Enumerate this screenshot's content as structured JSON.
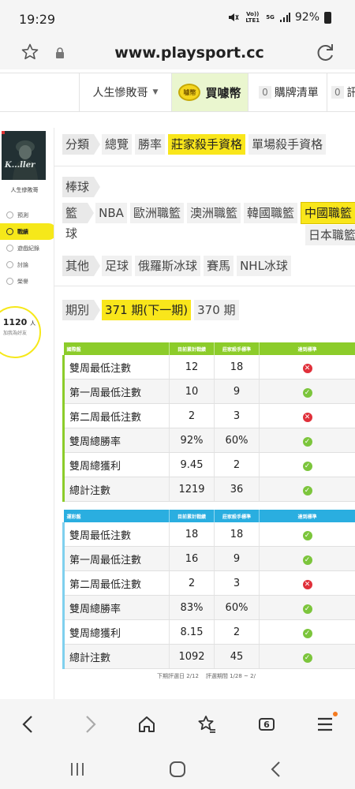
{
  "status": {
    "time": "19:29",
    "volte": "Vo)) LTE1",
    "network": "5G",
    "battery": "92%"
  },
  "browser": {
    "url": "www.playsport.cc",
    "tab_count": "6"
  },
  "topnav": {
    "user": "人生慘敗哥",
    "buy": "買噱幣",
    "coin_label": "噱幣",
    "cart_count": "0",
    "cart": "購牌清單",
    "msg_count": "0",
    "msg": "訊"
  },
  "sidebar": {
    "avatar_text": "K...ller",
    "name": "人生慘敗哥",
    "items": [
      {
        "label": "預測"
      },
      {
        "label": "戰績"
      },
      {
        "label": "遊戲紀錄"
      },
      {
        "label": "討論"
      },
      {
        "label": "榮譽"
      }
    ],
    "points": "1120",
    "points_prefix": "有",
    "points_suffix": "人",
    "points_sub": "加我為好友"
  },
  "filters": {
    "category_label": "分類",
    "categories": [
      "總覽",
      "勝率",
      "莊家殺手資格",
      "單場殺手資格"
    ],
    "baseball_label": "棒球",
    "basketball_label": "籃球",
    "basketball": [
      "NBA",
      "歐洲職籃",
      "澳洲職籃",
      "韓國職籃",
      "中國職籃",
      "日本職籃"
    ],
    "other_label": "其他",
    "other": [
      "足球",
      "俄羅斯冰球",
      "賽馬",
      "NHL冰球"
    ],
    "period_label": "期別",
    "periods": [
      "371 期(下一期)",
      "370 期"
    ]
  },
  "table1": {
    "headers": [
      "國際盤",
      "目前累計戰績",
      "莊家殺手標準",
      "達到標準"
    ],
    "rows": [
      {
        "name": "雙周最低注數",
        "current": "12",
        "standard": "18",
        "status": "fail"
      },
      {
        "name": "第一周最低注數",
        "current": "10",
        "standard": "9",
        "status": "pass"
      },
      {
        "name": "第二周最低注數",
        "current": "2",
        "standard": "3",
        "status": "fail"
      },
      {
        "name": "雙周總勝率",
        "current": "92%",
        "standard": "60%",
        "status": "pass"
      },
      {
        "name": "雙周總獲利",
        "current": "9.45",
        "standard": "2",
        "status": "pass"
      },
      {
        "name": "總計注數",
        "current": "1219",
        "standard": "36",
        "status": "pass"
      }
    ]
  },
  "table2": {
    "headers": [
      "運彩盤",
      "目前累計戰績",
      "莊家殺手標準",
      "達到標準"
    ],
    "rows": [
      {
        "name": "雙周最低注數",
        "current": "18",
        "standard": "18",
        "status": "pass"
      },
      {
        "name": "第一周最低注數",
        "current": "16",
        "standard": "9",
        "status": "pass"
      },
      {
        "name": "第二周最低注數",
        "current": "2",
        "standard": "3",
        "status": "fail"
      },
      {
        "name": "雙周總勝率",
        "current": "83%",
        "standard": "60%",
        "status": "pass"
      },
      {
        "name": "雙周總獲利",
        "current": "8.15",
        "standard": "2",
        "status": "pass"
      },
      {
        "name": "總計注數",
        "current": "1092",
        "standard": "45",
        "status": "pass"
      }
    ]
  },
  "footnote": {
    "next": "下期評選日 2/12",
    "range": "評選期間 1/28 ~ 2/"
  },
  "colors": {
    "accent_yellow": "#f9e61b",
    "intl_green": "#8ccc2a",
    "lottery_blue": "#2aaee0",
    "pass": "#7cc53c",
    "fail": "#e0303a"
  },
  "icons": [
    "mute-icon",
    "wifi-icon",
    "signal-icon",
    "battery-icon",
    "bookmark-star-icon",
    "lock-icon",
    "reload-icon",
    "back-icon",
    "forward-icon",
    "home-icon",
    "bookmarks-icon",
    "tabs-icon",
    "menu-icon",
    "recent-apps-icon",
    "android-home-icon",
    "android-back-icon"
  ]
}
